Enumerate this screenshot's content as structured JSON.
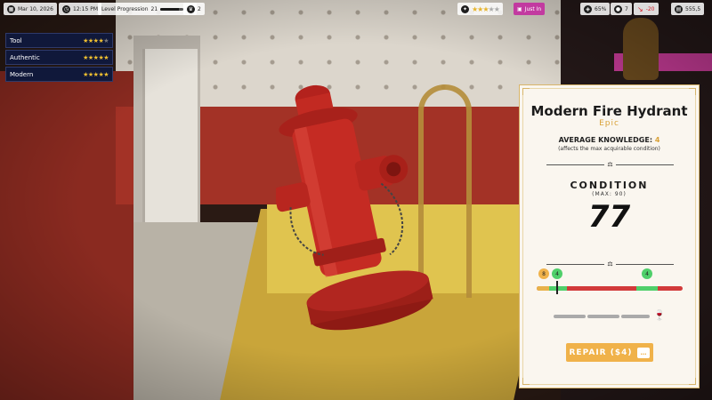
{
  "topbar": {
    "date": "Mar 10, 2026",
    "time": "12:15 PM",
    "level_label": "Level Progression",
    "level_current": "21",
    "level_next": "22",
    "level_progress": 0.8,
    "stat_a": "2",
    "rating_stars": 3,
    "rating_max": 5,
    "pink_tag": "Just In",
    "stat_percent": "65%",
    "stat_count": "7",
    "money_delta": "-20",
    "money_total": "555,5"
  },
  "tags": [
    {
      "label": "Tool",
      "stars": 4,
      "max": 5
    },
    {
      "label": "Authentic",
      "stars": 5,
      "max": 5
    },
    {
      "label": "Modern",
      "stars": 5,
      "max": 5
    }
  ],
  "panel": {
    "title": "Modern Fire Hydrant",
    "rarity": "Epic",
    "knowledge_label": "AVERAGE KNOWLEDGE:",
    "knowledge_value": "4",
    "knowledge_sub": "(affects the max acquirable condition)",
    "condition_label": "CONDITION",
    "condition_max": "(MAX: 90)",
    "condition_value": "77",
    "pin_a": "8",
    "pin_b": "4",
    "pin_c": "4",
    "repair_label": "REPAIR ($4)"
  },
  "colors": {
    "accent_gold": "#d9a238",
    "button": "#f0b24a",
    "bar_red": "#d23a3a",
    "bar_green": "#4fcf6a",
    "tag_bg": "#10183a"
  }
}
